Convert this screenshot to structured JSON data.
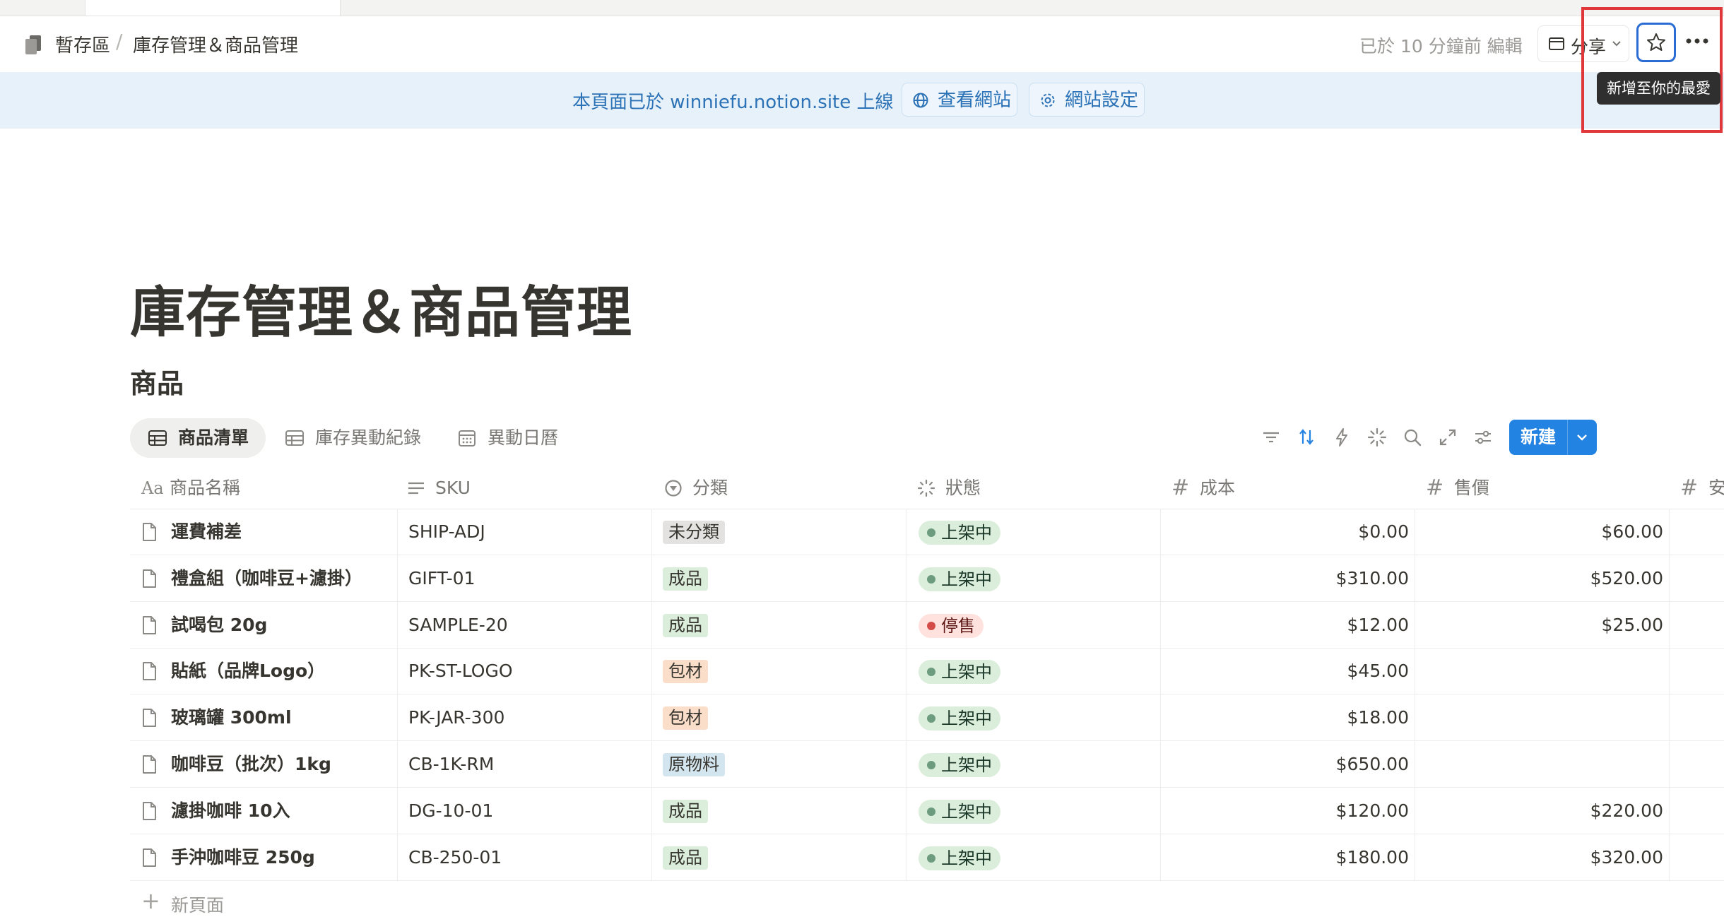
{
  "breadcrumb": {
    "workspace": "暫存區",
    "separator": "/",
    "page": "庫存管理＆商品管理"
  },
  "topbar": {
    "edited": "已於 10 分鐘前 編輯",
    "share_label": "分享",
    "tooltip": "新增至你的最愛"
  },
  "banner": {
    "message": "本頁面已於 winniefu.notion.site 上線",
    "view_site": "查看網站",
    "site_settings": "網站設定"
  },
  "page": {
    "title": "庫存管理＆商品管理",
    "section": "商品"
  },
  "views": {
    "products_list": "商品清單",
    "stock_log": "庫存異動紀錄",
    "calendar": "異動日曆"
  },
  "toolbar": {
    "new_label": "新建"
  },
  "columns": {
    "name": "商品名稱",
    "sku": "SKU",
    "category": "分類",
    "status": "狀態",
    "cost": "成本",
    "price": "售價",
    "next": "安"
  },
  "rows": [
    {
      "name": "運費補差",
      "sku": "SHIP-ADJ",
      "category": "未分類",
      "status": "上架中",
      "cost": "$0.00",
      "price": "$60.00"
    },
    {
      "name": "禮盒組（咖啡豆+濾掛）",
      "sku": "GIFT-01",
      "category": "成品",
      "status": "上架中",
      "cost": "$310.00",
      "price": "$520.00"
    },
    {
      "name": "試喝包 20g",
      "sku": "SAMPLE-20",
      "category": "成品",
      "status": "停售",
      "cost": "$12.00",
      "price": "$25.00"
    },
    {
      "name": "貼紙（品牌Logo）",
      "sku": "PK-ST-LOGO",
      "category": "包材",
      "status": "上架中",
      "cost": "$45.00",
      "price": ""
    },
    {
      "name": "玻璃罐 300ml",
      "sku": "PK-JAR-300",
      "category": "包材",
      "status": "上架中",
      "cost": "$18.00",
      "price": ""
    },
    {
      "name": "咖啡豆（批次）1kg",
      "sku": "CB-1K-RM",
      "category": "原物料",
      "status": "上架中",
      "cost": "$650.00",
      "price": ""
    },
    {
      "name": "濾掛咖啡 10入",
      "sku": "DG-10-01",
      "category": "成品",
      "status": "上架中",
      "cost": "$120.00",
      "price": "$220.00"
    },
    {
      "name": "手沖咖啡豆 250g",
      "sku": "CB-250-01",
      "category": "成品",
      "status": "上架中",
      "cost": "$180.00",
      "price": "$320.00"
    }
  ],
  "new_page": "新頁面",
  "colors": {
    "accent": "#2383e2",
    "banner_bg": "#e7f1fa",
    "highlight_box": "#e0383a",
    "category_uncategorized": "#e3e2e0",
    "category_finished": "#dbeddb",
    "category_packaging": "#fadec9",
    "category_raw": "#d3e5ef",
    "status_active": "#dbeddb",
    "status_discontinued": "#ffe2dd"
  }
}
